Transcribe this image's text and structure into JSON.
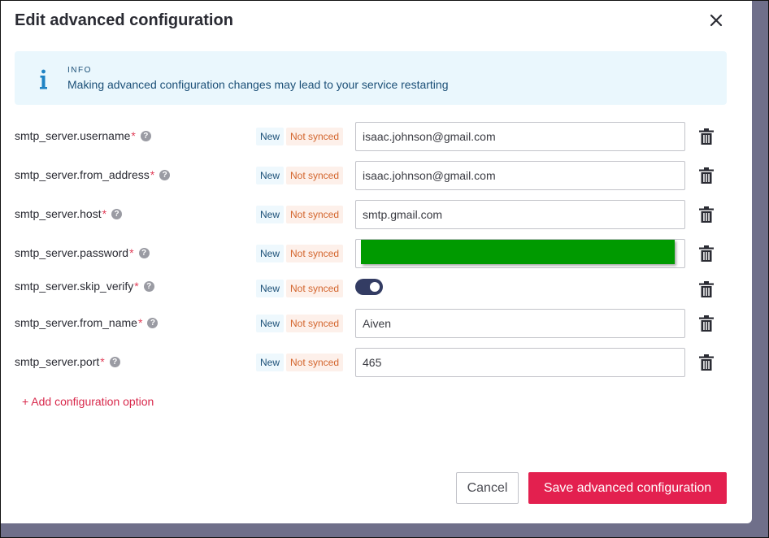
{
  "dialog": {
    "title": "Edit advanced configuration",
    "close_icon": "close-icon"
  },
  "info": {
    "icon": "info-icon",
    "label": "INFO",
    "text": "Making advanced configuration changes may lead to your service restarting"
  },
  "badges": {
    "new": "New",
    "not_synced": "Not synced"
  },
  "rows": [
    {
      "name": "smtp_server.username",
      "required": "*",
      "type": "text",
      "value": "isaac.johnson@gmail.com"
    },
    {
      "name": "smtp_server.from_address",
      "required": "*",
      "type": "text",
      "value": "isaac.johnson@gmail.com"
    },
    {
      "name": "smtp_server.host",
      "required": "*",
      "type": "text",
      "value": "smtp.gmail.com"
    },
    {
      "name": "smtp_server.password",
      "required": "*",
      "type": "password",
      "value": ""
    },
    {
      "name": "smtp_server.skip_verify",
      "required": "*",
      "type": "toggle",
      "value": "on"
    },
    {
      "name": "smtp_server.from_name",
      "required": "*",
      "type": "text",
      "value": "Aiven"
    },
    {
      "name": "smtp_server.port",
      "required": "*",
      "type": "text",
      "value": "465"
    }
  ],
  "help_glyph": "?",
  "add_option": "+ Add configuration option",
  "actions": {
    "cancel": "Cancel",
    "save": "Save advanced configuration"
  },
  "colors": {
    "accent": "#e3204f",
    "toggle_on": "#333c63",
    "redaction": "#009a00",
    "info_bg": "#eaf7fd"
  }
}
